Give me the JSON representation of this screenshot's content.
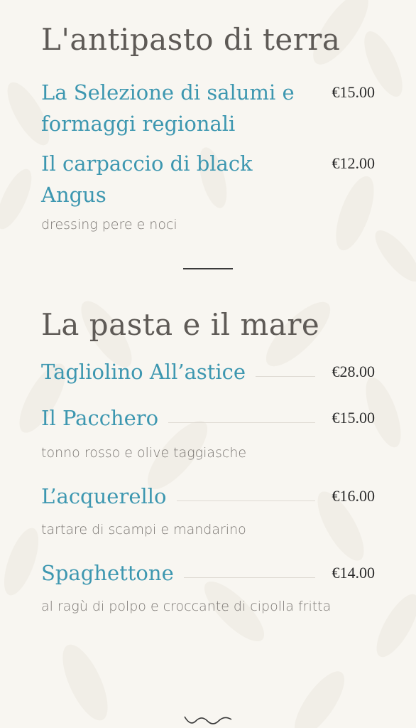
{
  "sections": [
    {
      "title": "L'antipasto di terra",
      "items": [
        {
          "name": "La Selezione di salumi e formaggi regionali",
          "price": "€15.00",
          "description": ""
        },
        {
          "name": "Il carpaccio di black Angus",
          "price": "€12.00",
          "description": "dressing pere e noci"
        }
      ]
    },
    {
      "title": "La pasta e il mare",
      "items": [
        {
          "name": "Tagliolino All’astice",
          "price": "€28.00",
          "description": ""
        },
        {
          "name": "Il Pacchero",
          "price": "€15.00",
          "description": "tonno rosso e olive taggiasche"
        },
        {
          "name": "L’acquerello",
          "price": "€16.00",
          "description": "tartare di scampi e mandarino"
        },
        {
          "name": "Spaghettone",
          "price": "€14.00",
          "description": "al ragù di polpo e croccante di cipolla fritta"
        }
      ]
    }
  ],
  "colors": {
    "background": "#f8f6f1",
    "title": "#5e5a56",
    "item_name": "#3d97b0",
    "price": "#2b2b2b",
    "description": "#7a7672"
  },
  "icons": {
    "divider": "divider-line",
    "bottom": "wave-ornament-icon"
  }
}
